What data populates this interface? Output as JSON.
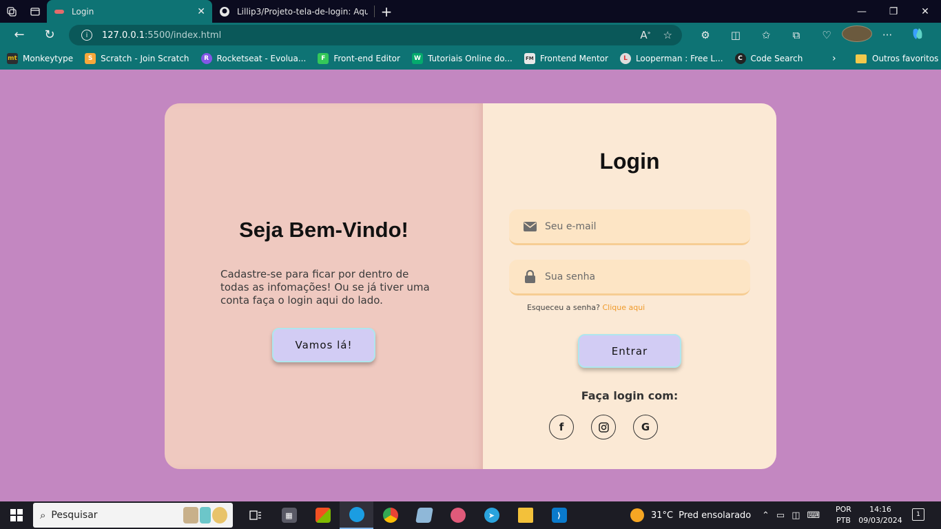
{
  "browser": {
    "tabs": [
      {
        "title": "Login",
        "active": true
      },
      {
        "title": "Lillip3/Projeto-tela-de-login: Aqu",
        "active": false
      }
    ],
    "url_host": "127.0.0.1",
    "url_path": ":5500/index.html",
    "bookmarks": [
      {
        "label": "Monkeytype",
        "icon": "mt",
        "color": "#2c2e31"
      },
      {
        "label": "Scratch - Join Scratch",
        "icon": "S",
        "color": "#f7a83b"
      },
      {
        "label": "Rocketseat - Evolua...",
        "icon": "R",
        "color": "#8257e5"
      },
      {
        "label": "Front-end Editor",
        "icon": "F",
        "color": "#34c759"
      },
      {
        "label": "Tutoriais Online do...",
        "icon": "W",
        "color": "#04aa6d"
      },
      {
        "label": "Frontend Mentor",
        "icon": "FM",
        "color": "#e8e8e8"
      },
      {
        "label": "Looperman : Free L...",
        "icon": "L",
        "color": "#d33"
      },
      {
        "label": "Code Search",
        "icon": "C",
        "color": "#333"
      }
    ],
    "other_favorites": "Outros favoritos"
  },
  "welcome": {
    "heading": "Seja Bem-Vindo!",
    "text": "Cadastre-se para ficar por dentro de todas as infomações! Ou se já tiver uma conta faça o login aqui do lado.",
    "button": "Vamos lá!"
  },
  "login": {
    "title": "Login",
    "email_placeholder": "Seu e-mail",
    "password_placeholder": "Sua senha",
    "forgot_text": "Esqueceu a senha?",
    "forgot_link": "Clique aqui",
    "submit": "Entrar",
    "social_title": "Faça login com:",
    "social": [
      {
        "name": "facebook",
        "glyph": "f"
      },
      {
        "name": "instagram",
        "glyph": "◎"
      },
      {
        "name": "google",
        "glyph": "G"
      }
    ]
  },
  "taskbar": {
    "search_placeholder": "Pesquisar",
    "weather_temp": "31°C",
    "weather_desc": "Pred ensolarado",
    "lang_top": "POR",
    "lang_bottom": "PTB",
    "time": "14:16",
    "date": "09/03/2024",
    "notifications": "1"
  },
  "colors": {
    "page_bg": "#c387c1",
    "left_panel": "#efc9c0",
    "right_panel": "#fbe9d5",
    "button_bg": "#d2ccf4",
    "link": "#ef9a2a",
    "browser_accent": "#0e7374"
  }
}
